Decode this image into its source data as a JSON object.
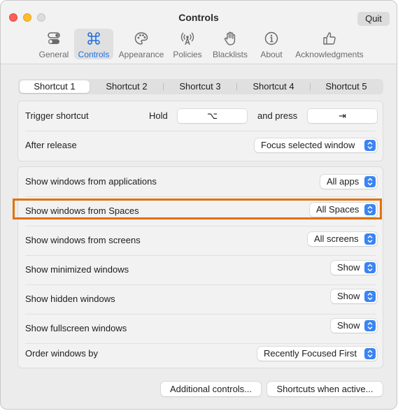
{
  "window": {
    "title": "Controls",
    "quit_label": "Quit"
  },
  "toolbar": {
    "tabs": [
      {
        "label": "General",
        "icon": "toggles-icon"
      },
      {
        "label": "Controls",
        "icon": "command-icon",
        "active": true
      },
      {
        "label": "Appearance",
        "icon": "palette-icon"
      },
      {
        "label": "Policies",
        "icon": "antenna-icon"
      },
      {
        "label": "Blacklists",
        "icon": "hand-icon"
      },
      {
        "label": "About",
        "icon": "info-icon"
      },
      {
        "label": "Acknowledgments",
        "icon": "thumbs-up-icon"
      }
    ]
  },
  "shortcuts": {
    "selected_index": 0,
    "tabs": [
      "Shortcut 1",
      "Shortcut 2",
      "Shortcut 3",
      "Shortcut 4",
      "Shortcut 5"
    ]
  },
  "trigger": {
    "label": "Trigger shortcut",
    "hold_label": "Hold",
    "hold_key": "⌥",
    "and_press_label": "and press",
    "press_key": "⇥"
  },
  "after_release": {
    "label": "After release",
    "value": "Focus selected window"
  },
  "settings": {
    "applications": {
      "label": "Show windows from applications",
      "value": "All apps"
    },
    "spaces": {
      "label": "Show windows from Spaces",
      "value": "All Spaces"
    },
    "screens": {
      "label": "Show windows from screens",
      "value": "All screens"
    },
    "minimized": {
      "label": "Show minimized windows",
      "value": "Show"
    },
    "hidden": {
      "label": "Show hidden windows",
      "value": "Show"
    },
    "fullscreen": {
      "label": "Show fullscreen windows",
      "value": "Show"
    },
    "order": {
      "label": "Order windows by",
      "value": "Recently Focused First"
    }
  },
  "footer": {
    "additional_label": "Additional controls...",
    "shortcuts_when_active_label": "Shortcuts when active..."
  },
  "colors": {
    "accent": "#3a84f4",
    "highlight": "#e2710a",
    "active_tab": "#1f6ee0"
  }
}
